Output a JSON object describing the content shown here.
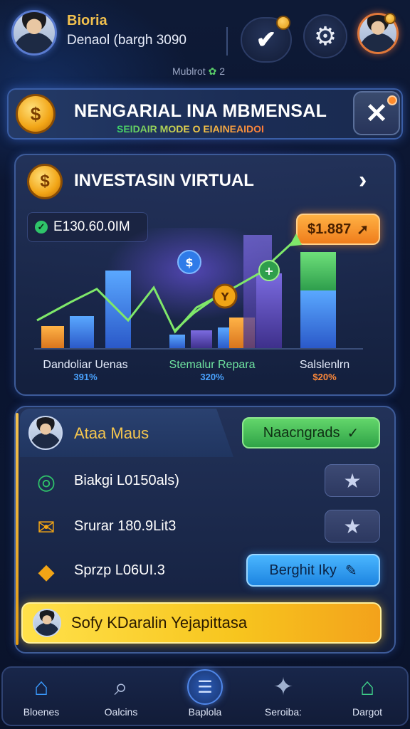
{
  "header": {
    "user_name": "Bioria",
    "balance": "Denaol (bargh 3090",
    "status_text": "Mublrot",
    "status_value": "2"
  },
  "banner": {
    "title": "NENGARIAL INA MBMENSAL",
    "subtitle": "SEIDAIR MODE O EIAINEAIDOI"
  },
  "invest": {
    "title": "INVESTASIN VIRTUAL",
    "balance": "E130.60.0IM",
    "price": "$1.887",
    "metrics": [
      {
        "label": "Dandoliar Uenas",
        "value": "391%",
        "value_color": "#4aa3ff"
      },
      {
        "label": "Stemalur Repara",
        "value": "320%",
        "value_color": "#4aa3ff"
      },
      {
        "label": "Salslenlrn",
        "value": "$20%",
        "value_color": "#ff8a3a"
      }
    ]
  },
  "user_card": {
    "name": "Ataa Maus",
    "upgrade_label": "Naacngrads",
    "rows": [
      {
        "text": "Biakgi L0150als)",
        "icon": "target-icon"
      },
      {
        "text": "Srurar 180.9Lit3",
        "icon": "envelope-icon"
      },
      {
        "text": "Sprzp L06UI.3",
        "icon": "gem-icon"
      }
    ],
    "action_label": "Berghit Iky",
    "cta_label": "Sofy KDaralin Yejapittasa"
  },
  "nav": {
    "items": [
      {
        "label": "Bloenes"
      },
      {
        "label": "Oalcins"
      },
      {
        "label": "Baplola"
      },
      {
        "label": "Seroiba:"
      },
      {
        "label": "Dargot"
      }
    ]
  },
  "colors": {
    "accent_gold": "#f2c14e",
    "accent_green": "#2fc46a",
    "accent_orange": "#ef7d1c",
    "accent_blue": "#1d84e0"
  }
}
